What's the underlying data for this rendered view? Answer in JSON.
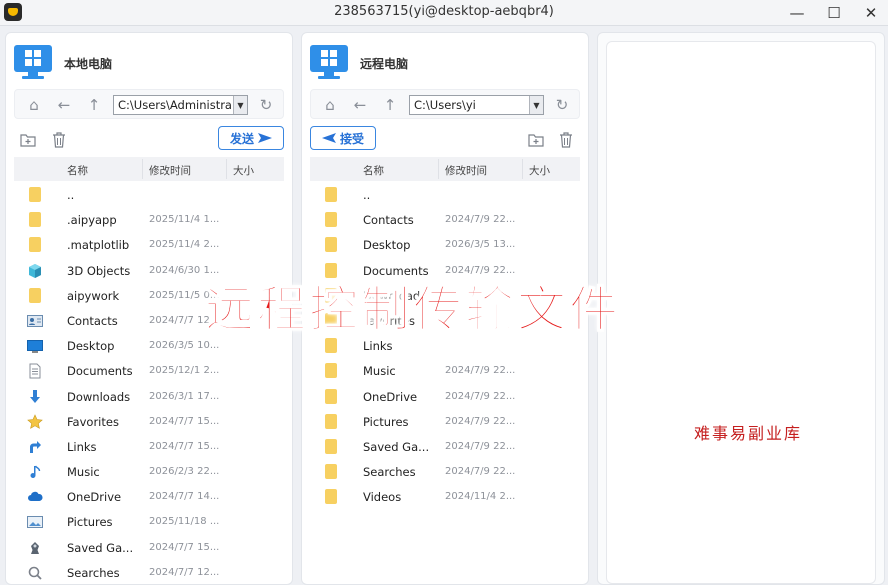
{
  "window": {
    "title": "238563715(yi@desktop-aebqbr4)",
    "minimize": "—",
    "maximize": "☐",
    "close": "✕"
  },
  "local": {
    "title": "本地电脑",
    "path": "C:\\Users\\Administra",
    "send_label": "发送",
    "columns": {
      "name": "名称",
      "modified": "修改时间",
      "size": "大小"
    },
    "rows": [
      {
        "name": "..",
        "date": "",
        "icon": "folder-icon"
      },
      {
        "name": ".aipyapp",
        "date": "2025/11/4 1...",
        "icon": "folder-icon"
      },
      {
        "name": ".matplotlib",
        "date": "2025/11/4 2...",
        "icon": "folder-icon"
      },
      {
        "name": "3D Objects",
        "date": "2024/6/30 1...",
        "icon": "cube-icon"
      },
      {
        "name": "aipywork",
        "date": "2025/11/5 0...",
        "icon": "folder-icon"
      },
      {
        "name": "Contacts",
        "date": "2024/7/7 12...",
        "icon": "contact-card-icon"
      },
      {
        "name": "Desktop",
        "date": "2026/3/5 10...",
        "icon": "desktop-icon"
      },
      {
        "name": "Documents",
        "date": "2025/12/1 2...",
        "icon": "document-icon"
      },
      {
        "name": "Downloads",
        "date": "2026/3/1 17...",
        "icon": "download-arrow-icon"
      },
      {
        "name": "Favorites",
        "date": "2024/7/7 15...",
        "icon": "star-icon"
      },
      {
        "name": "Links",
        "date": "2024/7/7 15...",
        "icon": "link-arrow-icon"
      },
      {
        "name": "Music",
        "date": "2026/2/3 22...",
        "icon": "music-note-icon"
      },
      {
        "name": "OneDrive",
        "date": "2024/7/7 14...",
        "icon": "cloud-icon"
      },
      {
        "name": "Pictures",
        "date": "2025/11/18 ...",
        "icon": "picture-icon"
      },
      {
        "name": "Saved Ga...",
        "date": "2024/7/7 15...",
        "icon": "game-piece-icon"
      },
      {
        "name": "Searches",
        "date": "2024/7/7 12...",
        "icon": "search-icon"
      }
    ]
  },
  "remote": {
    "title": "远程电脑",
    "path": "C:\\Users\\yi",
    "receive_label": "接受",
    "columns": {
      "name": "名称",
      "modified": "修改时间",
      "size": "大小"
    },
    "rows": [
      {
        "name": "..",
        "date": ""
      },
      {
        "name": "Contacts",
        "date": "2024/7/9 22..."
      },
      {
        "name": "Desktop",
        "date": "2026/3/5 13..."
      },
      {
        "name": "Documents",
        "date": "2024/7/9 22..."
      },
      {
        "name": "Downloads",
        "date": ""
      },
      {
        "name": "Favorites",
        "date": ""
      },
      {
        "name": "Links",
        "date": ""
      },
      {
        "name": "Music",
        "date": "2024/7/9 22..."
      },
      {
        "name": "OneDrive",
        "date": "2024/7/9 22..."
      },
      {
        "name": "Pictures",
        "date": "2024/7/9 22..."
      },
      {
        "name": "Saved Ga...",
        "date": "2024/7/9 22..."
      },
      {
        "name": "Searches",
        "date": "2024/7/9 22..."
      },
      {
        "name": "Videos",
        "date": "2024/11/4 2..."
      }
    ]
  },
  "overlay_caption": "远程控制传输文件",
  "watermark": "难事易副业库",
  "colors": {
    "accent": "#2f8fe8",
    "folder": "#f7d061",
    "caption": "#e51a1a"
  }
}
